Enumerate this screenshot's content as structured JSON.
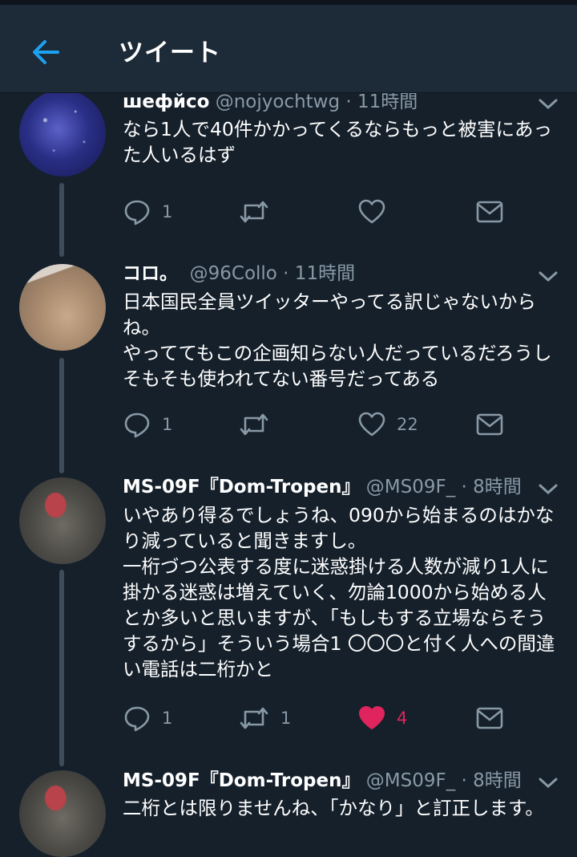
{
  "header": {
    "title": "ツイート",
    "back_icon": "arrow-left-icon"
  },
  "colors": {
    "background": "#15202b",
    "header": "#1d2a37",
    "accent": "#1da1f2",
    "like_active": "#e0245e",
    "muted": "#8899a6"
  },
  "tweets": [
    {
      "display_name": "шефйсо",
      "handle_time": "@nojyochtwg · 11時間",
      "body": "なら1人で40件かかってくるならもっと被害にあった人いるはず",
      "avatar_icon": "galaxy-avatar",
      "reply_count": "1",
      "retweet_count": "",
      "like_count": "",
      "liked": false
    },
    {
      "display_name": "コロ。",
      "handle_time": "@96Collo · 11時間",
      "body": "日本国民全員ツイッターやってる訳じゃないからね。\nやっててもこの企画知らない人だっているだろうしそもそも使われてない番号だってある",
      "avatar_icon": "drink-avatar",
      "reply_count": "1",
      "retweet_count": "",
      "like_count": "22",
      "liked": false
    },
    {
      "display_name": "MS-09F『Dom-Tropen』",
      "handle_time": "@MS09F_ · 8時間",
      "body": "いやあり得るでしょうね、090から始まるのはかなり減っていると聞きますし。\n一桁づつ公表する度に迷惑掛ける人数が減り1人に掛かる迷惑は増えていく、勿論1000から始める人とか多いと思いますが、「もしもする立場ならそうするから」そういう場合1 〇〇〇と付く人への間違い電話は二桁かと",
      "avatar_icon": "mech-avatar",
      "reply_count": "1",
      "retweet_count": "1",
      "like_count": "4",
      "liked": true
    },
    {
      "display_name": "MS-09F『Dom-Tropen』",
      "handle_time": "@MS09F_ · 8時間",
      "body": "二桁とは限りませんね、「かなり」と訂正します。",
      "avatar_icon": "mech-avatar",
      "reply_count": "",
      "retweet_count": "",
      "like_count": "",
      "liked": false
    }
  ]
}
